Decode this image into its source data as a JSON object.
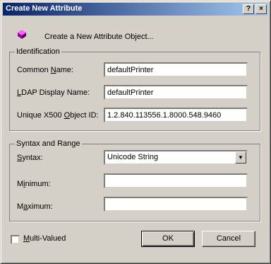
{
  "window": {
    "title": "Create New Attribute",
    "help_btn": "?",
    "close_btn": "×"
  },
  "header": {
    "icon": "attribute-object-icon",
    "text": "Create a New Attribute Object..."
  },
  "identification": {
    "legend": "Identification",
    "common_name_label": "Common Name:",
    "common_name_value": "defaultPrinter",
    "ldap_label": "LDAP Display Name:",
    "ldap_value": "defaultPrinter",
    "oid_label": "Unique X500 Object ID:",
    "oid_value": "1.2.840.113556.1.8000.548.9460"
  },
  "syntax_range": {
    "legend": "Syntax and Range",
    "syntax_label": "Syntax:",
    "syntax_value": "Unicode String",
    "minimum_label": "Minimum:",
    "minimum_value": "",
    "maximum_label": "Maximum:",
    "maximum_value": ""
  },
  "footer": {
    "multivalued_label": "Multi-Valued",
    "multivalued_checked": false,
    "ok_label": "OK",
    "cancel_label": "Cancel"
  },
  "colors": {
    "titlebar_start": "#0a246a",
    "titlebar_end": "#a6caf0",
    "face": "#d4d0c8",
    "icon_magenta": "#c000c0"
  }
}
